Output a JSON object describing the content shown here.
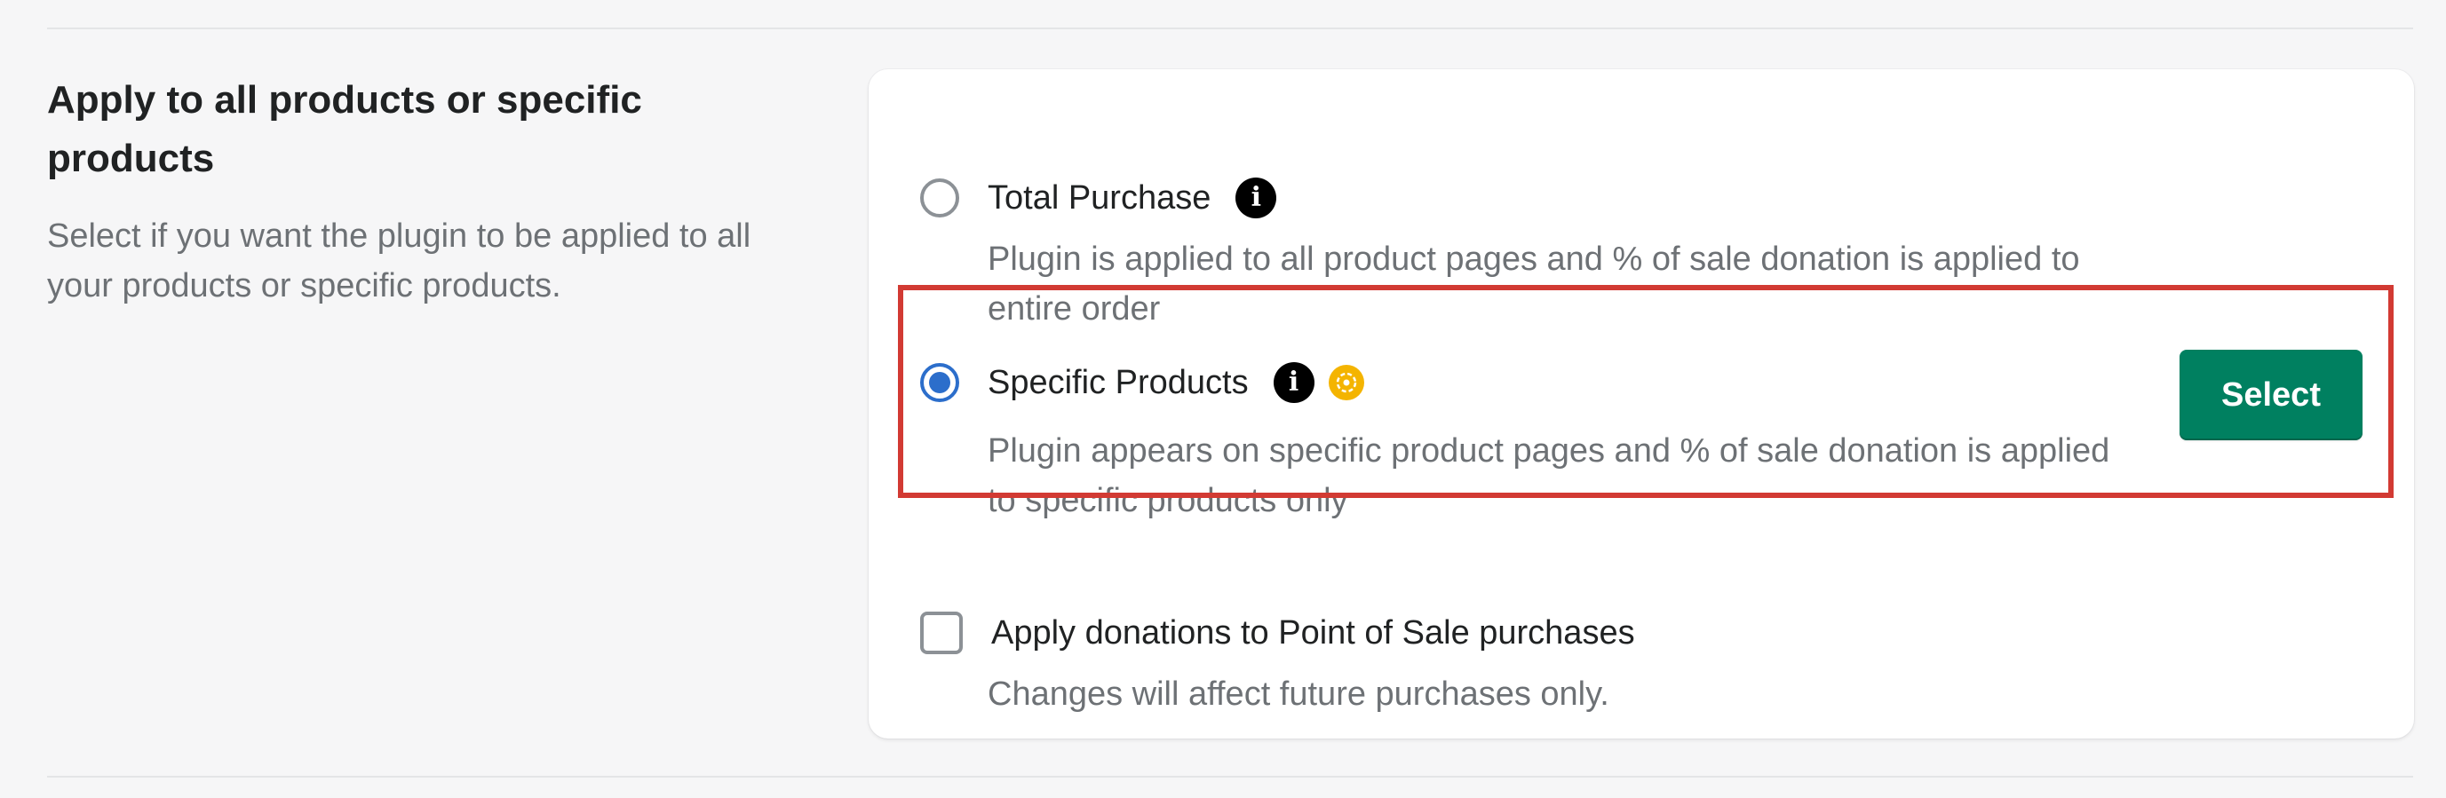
{
  "section": {
    "title": "Apply to all products or specific products",
    "description": "Select if you want the plugin to be applied to all your products or specific products."
  },
  "options": [
    {
      "label": "Total Purchase",
      "description": "Plugin is applied to all product pages and % of sale donation is applied to entire order",
      "selected": false,
      "icons": [
        "info-icon"
      ]
    },
    {
      "label": "Specific Products",
      "description": "Plugin appears on specific product pages and % of sale donation is applied to specific products only",
      "selected": true,
      "icons": [
        "info-icon",
        "star-badge-icon"
      ],
      "button_label": "Select"
    }
  ],
  "pos_checkbox": {
    "label": "Apply donations to Point of Sale purchases",
    "description": "Changes will affect future purchases only.",
    "checked": false
  },
  "colors": {
    "primary_button": "#008060",
    "radio_selected": "#2c6ecb",
    "highlight_border": "#d23a33",
    "badge": "#f4b400"
  }
}
